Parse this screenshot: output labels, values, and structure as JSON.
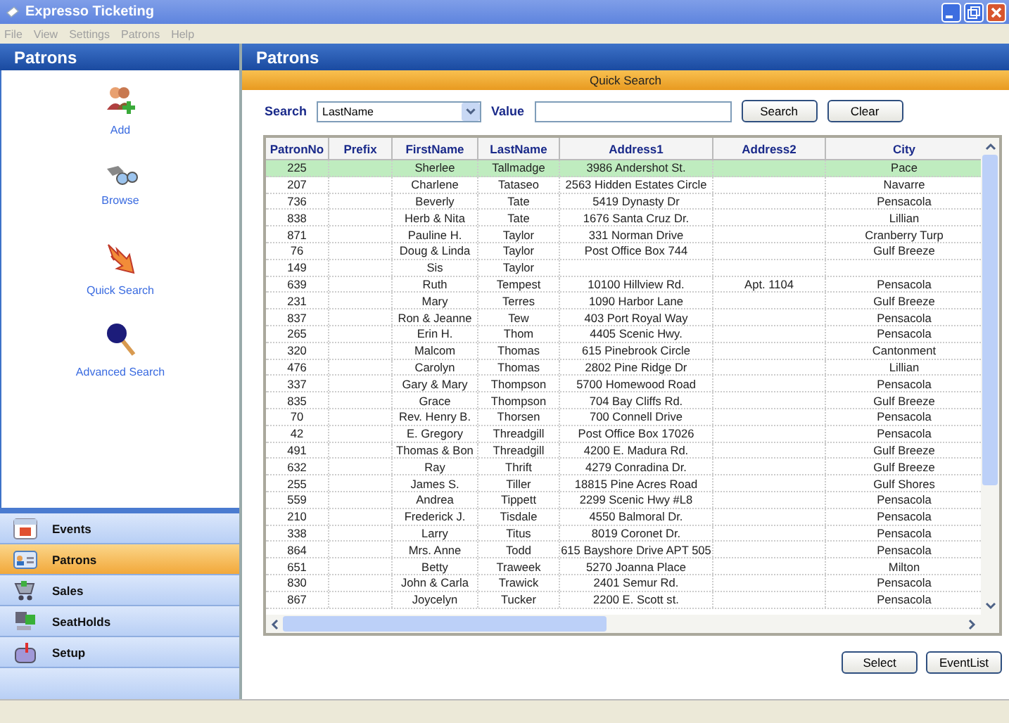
{
  "window": {
    "title": "Expresso Ticketing"
  },
  "menu": [
    "File",
    "View",
    "Settings",
    "Patrons",
    "Help"
  ],
  "sidebar": {
    "title": "Patrons",
    "actions": [
      {
        "label": "Add",
        "kind": "add"
      },
      {
        "label": "Browse",
        "kind": "browse"
      },
      {
        "label": "Quick Search",
        "kind": "quick"
      },
      {
        "label": "Advanced Search",
        "kind": "advanced"
      }
    ],
    "nav": [
      {
        "label": "Events",
        "kind": "events",
        "selected": false
      },
      {
        "label": "Patrons",
        "kind": "patrons",
        "selected": true
      },
      {
        "label": "Sales",
        "kind": "sales",
        "selected": false
      },
      {
        "label": "SeatHolds",
        "kind": "seatholds",
        "selected": false
      },
      {
        "label": "Setup",
        "kind": "setup",
        "selected": false
      }
    ]
  },
  "main": {
    "title": "Patrons",
    "section": "Quick Search",
    "search_label": "Search",
    "search_field": "LastName",
    "value_label": "Value",
    "search_button": "Search",
    "clear_button": "Clear",
    "table": {
      "columns": [
        "PatronNo",
        "Prefix",
        "FirstName",
        "LastName",
        "Address1",
        "Address2",
        "City"
      ],
      "rows": [
        {
          "patron_no": "225",
          "first_name": "Sherlee",
          "last_name": "Tallmadge",
          "address1": "3986 Andershot St.",
          "city": "Pace",
          "selected": true
        },
        {
          "patron_no": "207",
          "first_name": "Charlene",
          "last_name": "Tataseo",
          "address1": "2563 Hidden Estates Circle",
          "city": "Navarre",
          "selected": false
        },
        {
          "patron_no": "736",
          "first_name": "Beverly",
          "last_name": "Tate",
          "address1": "5419 Dynasty Dr",
          "city": "Pensacola",
          "selected": false
        },
        {
          "patron_no": "838",
          "first_name": "Herb & Nita",
          "last_name": "Tate",
          "address1": "1676 Santa Cruz Dr.",
          "city": "Lillian",
          "selected": false
        },
        {
          "patron_no": "871",
          "first_name": "Pauline H.",
          "last_name": "Taylor",
          "address1": "331 Norman Drive",
          "city": "Cranberry Turp",
          "selected": false
        },
        {
          "patron_no": "76",
          "first_name": "Doug & Linda",
          "last_name": "Taylor",
          "address1": "Post Office Box 744",
          "city": "Gulf Breeze",
          "selected": false
        },
        {
          "patron_no": "149",
          "first_name": "Sis",
          "last_name": "Taylor",
          "selected": false
        },
        {
          "patron_no": "639",
          "first_name": "Ruth",
          "last_name": "Tempest",
          "address1": "10100 Hillview Rd.",
          "address2": "Apt. 1104",
          "city": "Pensacola",
          "selected": false
        },
        {
          "patron_no": "231",
          "first_name": "Mary",
          "last_name": "Terres",
          "address1": "1090 Harbor Lane",
          "city": "Gulf Breeze",
          "selected": false
        },
        {
          "patron_no": "837",
          "first_name": "Ron & Jeanne",
          "last_name": "Tew",
          "address1": "403 Port Royal Way",
          "city": "Pensacola",
          "selected": false
        },
        {
          "patron_no": "265",
          "first_name": "Erin H.",
          "last_name": "Thom",
          "address1": "4405 Scenic Hwy.",
          "city": "Pensacola",
          "selected": false
        },
        {
          "patron_no": "320",
          "first_name": "Malcom",
          "last_name": "Thomas",
          "address1": "615 Pinebrook Circle",
          "city": "Cantonment",
          "selected": false
        },
        {
          "patron_no": "476",
          "first_name": "Carolyn",
          "last_name": "Thomas",
          "address1": "2802 Pine Ridge Dr",
          "city": "Lillian",
          "selected": false
        },
        {
          "patron_no": "337",
          "first_name": "Gary & Mary",
          "last_name": "Thompson",
          "address1": "5700 Homewood Road",
          "city": "Pensacola",
          "selected": false
        },
        {
          "patron_no": "835",
          "first_name": "Grace",
          "last_name": "Thompson",
          "address1": "704 Bay Cliffs Rd.",
          "city": "Gulf Breeze",
          "selected": false
        },
        {
          "patron_no": "70",
          "first_name": "Rev. Henry B.",
          "last_name": "Thorsen",
          "address1": "700 Connell Drive",
          "city": "Pensacola",
          "selected": false
        },
        {
          "patron_no": "42",
          "first_name": "E. Gregory",
          "last_name": "Threadgill",
          "address1": "Post Office Box 17026",
          "city": "Pensacola",
          "selected": false
        },
        {
          "patron_no": "491",
          "first_name": "Thomas  & Bon",
          "last_name": "Threadgill",
          "address1": "4200 E. Madura Rd.",
          "city": "Gulf Breeze",
          "selected": false
        },
        {
          "patron_no": "632",
          "first_name": "Ray",
          "last_name": "Thrift",
          "address1": "4279 Conradina Dr.",
          "city": "Gulf Breeze",
          "selected": false
        },
        {
          "patron_no": "255",
          "first_name": "James S.",
          "last_name": "Tiller",
          "address1": "18815 Pine Acres Road",
          "city": "Gulf Shores",
          "selected": false
        },
        {
          "patron_no": "559",
          "first_name": "Andrea",
          "last_name": "Tippett",
          "address1": "2299 Scenic Hwy #L8",
          "city": "Pensacola",
          "selected": false
        },
        {
          "patron_no": "210",
          "first_name": "Frederick J.",
          "last_name": "Tisdale",
          "address1": "4550 Balmoral Dr.",
          "city": "Pensacola",
          "selected": false
        },
        {
          "patron_no": "338",
          "first_name": "Larry",
          "last_name": "Titus",
          "address1": "8019 Coronet Dr.",
          "city": "Pensacola",
          "selected": false
        },
        {
          "patron_no": "864",
          "first_name": "Mrs. Anne",
          "last_name": "Todd",
          "address1": "615 Bayshore Drive APT 505",
          "city": "Pensacola",
          "selected": false
        },
        {
          "patron_no": "651",
          "first_name": "Betty",
          "last_name": "Traweek",
          "address1": "5270 Joanna Place",
          "city": "Milton",
          "selected": false
        },
        {
          "patron_no": "830",
          "first_name": "John & Carla",
          "last_name": "Trawick",
          "address1": "2401 Semur Rd.",
          "city": "Pensacola",
          "selected": false
        },
        {
          "patron_no": "867",
          "first_name": "Joycelyn",
          "last_name": "Tucker",
          "address1": "2200 E. Scott st.",
          "city": "Pensacola",
          "selected": false
        }
      ]
    },
    "buttons": [
      "Select",
      "EventList"
    ]
  }
}
